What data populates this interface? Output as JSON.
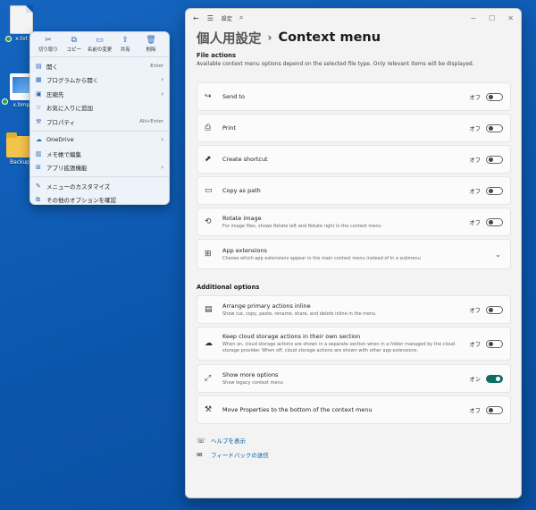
{
  "desktop": {
    "icons": [
      {
        "label": "x.txt",
        "icon": "text-file-icon"
      },
      {
        "label": "x.bmp",
        "icon": "bitmap-file-icon"
      },
      {
        "label": "Backup",
        "icon": "folder-icon"
      }
    ]
  },
  "context_menu": {
    "actions": [
      {
        "label": "切り取り",
        "icon": "cut-icon"
      },
      {
        "label": "コピー",
        "icon": "copy-icon"
      },
      {
        "label": "名前の変更",
        "icon": "rename-icon"
      },
      {
        "label": "共有",
        "icon": "share-icon"
      },
      {
        "label": "削除",
        "icon": "delete-icon"
      }
    ],
    "items": [
      {
        "label": "開く",
        "shortcut": "Enter",
        "submenu": false,
        "icon": "open-icon"
      },
      {
        "label": "プログラムから開く",
        "shortcut": "",
        "submenu": true,
        "icon": "open-with-icon"
      },
      {
        "label": "圧縮先",
        "shortcut": "",
        "submenu": true,
        "icon": "compress-icon"
      },
      {
        "label": "お気に入りに追加",
        "shortcut": "",
        "submenu": false,
        "icon": "star-icon"
      },
      {
        "label": "プロパティ",
        "shortcut": "Alt+Enter",
        "submenu": false,
        "icon": "wrench-icon"
      },
      {
        "label": "OneDrive",
        "shortcut": "",
        "submenu": true,
        "icon": "cloud-icon"
      },
      {
        "label": "メモ帳で編集",
        "shortcut": "",
        "submenu": false,
        "icon": "notepad-icon"
      },
      {
        "label": "アプリ拡張機能",
        "shortcut": "",
        "submenu": true,
        "icon": "app-extension-icon"
      },
      {
        "label": "メニューのカスタマイズ",
        "shortcut": "",
        "submenu": false,
        "icon": "edit-icon"
      },
      {
        "label": "その他のオプションを確認",
        "shortcut": "",
        "submenu": false,
        "icon": "more-options-icon"
      }
    ]
  },
  "window": {
    "title": "設定",
    "breadcrumb_parent": "個人用設定",
    "breadcrumb_current": "Context menu",
    "file_actions": {
      "title": "File actions",
      "description": "Available context menu options depend on the selected file type. Only relevant items will be displayed."
    },
    "cards": [
      {
        "name": "Send to",
        "sub": "",
        "state": "オフ",
        "on": false
      },
      {
        "name": "Print",
        "sub": "",
        "state": "オフ",
        "on": false
      },
      {
        "name": "Create shortcut",
        "sub": "",
        "state": "オフ",
        "on": false
      },
      {
        "name": "Copy as path",
        "sub": "",
        "state": "オフ",
        "on": false
      },
      {
        "name": "Rotate image",
        "sub": "For image files, shows Rotate left and Rotate right in the context menu",
        "state": "オフ",
        "on": false
      },
      {
        "name": "App extensions",
        "sub": "Choose which app extensions appear in the main context menu instead of in a submenu",
        "state": "",
        "on": null
      }
    ],
    "additional": {
      "title": "Additional options",
      "cards": [
        {
          "name": "Arrange primary actions inline",
          "sub": "Show cut, copy, paste, rename, share, and delete inline in the menu",
          "state": "オフ",
          "on": false
        },
        {
          "name": "Keep cloud storage actions in their own section",
          "sub": "When on, cloud storage actions are shown in a separate section when in a folder managed by the cloud storage provider. When off, cloud storage actions are shown with other app extensions.",
          "state": "オフ",
          "on": false
        },
        {
          "name": "Show more options",
          "sub": "Show legacy context menu",
          "state": "オン",
          "on": true
        },
        {
          "name": "Move Properties to the bottom of the context menu",
          "sub": "",
          "state": "オフ",
          "on": false
        }
      ]
    },
    "links": [
      {
        "label": "ヘルプを表示",
        "icon": "help-icon"
      },
      {
        "label": "フィードバックの送信",
        "icon": "feedback-icon"
      }
    ],
    "accent": "#0f6e64"
  }
}
